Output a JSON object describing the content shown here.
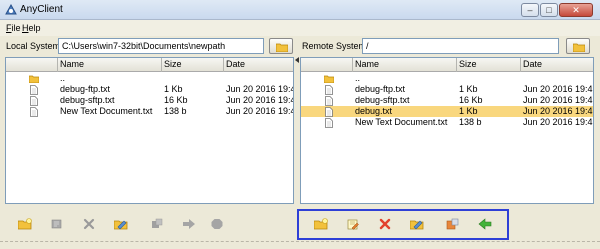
{
  "window": {
    "title": "AnyClient",
    "min": "–",
    "max": "□",
    "close": "✕"
  },
  "menu": [
    {
      "mnemonic": "F",
      "rest": "ile"
    },
    {
      "mnemonic": "H",
      "rest": "elp"
    }
  ],
  "local": {
    "label": "Local System",
    "path": "C:\\Users\\win7-32bit\\Documents\\newpath",
    "columns": [
      "",
      "Name",
      "Size",
      "Date"
    ],
    "rows": [
      {
        "icon": "folder-icon",
        "name": "..",
        "size": "",
        "date": ""
      },
      {
        "icon": "file-icon",
        "name": "debug-ftp.txt",
        "size": "1 Kb",
        "date": "Jun 20 2016 19:4..."
      },
      {
        "icon": "file-icon",
        "name": "debug-sftp.txt",
        "size": "16 Kb",
        "date": "Jun 20 2016 19:4..."
      },
      {
        "icon": "file-icon",
        "name": "New Text Document.txt",
        "size": "138 b",
        "date": "Jun 20 2016 19:4..."
      }
    ]
  },
  "remote": {
    "label": "Remote System",
    "path": "/",
    "columns": [
      "",
      "Name",
      "Size",
      "Date"
    ],
    "rows": [
      {
        "icon": "folder-icon",
        "name": "..",
        "size": "",
        "date": ""
      },
      {
        "icon": "file-icon",
        "name": "debug-ftp.txt",
        "size": "1 Kb",
        "date": "Jun 20 2016 19:4..."
      },
      {
        "icon": "file-icon",
        "name": "debug-sftp.txt",
        "size": "16 Kb",
        "date": "Jun 20 2016 19:4..."
      },
      {
        "icon": "file-icon",
        "name": "debug.txt",
        "size": "1 Kb",
        "date": "Jun 20 2016 19:4...",
        "selected": true
      },
      {
        "icon": "file-icon",
        "name": "New Text Document.txt",
        "size": "138 b",
        "date": "Jun 20 2016 19:4..."
      }
    ]
  },
  "toolbars": {
    "local": [
      "new-folder-icon",
      "rename-icon",
      "delete-icon",
      "edit-icon",
      "properties-icon",
      "upload-arrow-icon",
      "stop-icon"
    ],
    "remote": [
      "new-folder-icon",
      "rename-icon",
      "delete-icon",
      "edit-icon",
      "properties-icon",
      "download-arrow-icon"
    ]
  },
  "colors": {
    "selection": "#f9d77e",
    "highlight_box": "#2e3fd6",
    "folder": "#f2c13c",
    "delete": "#e2402d",
    "arrow_green": "#44b33a"
  }
}
